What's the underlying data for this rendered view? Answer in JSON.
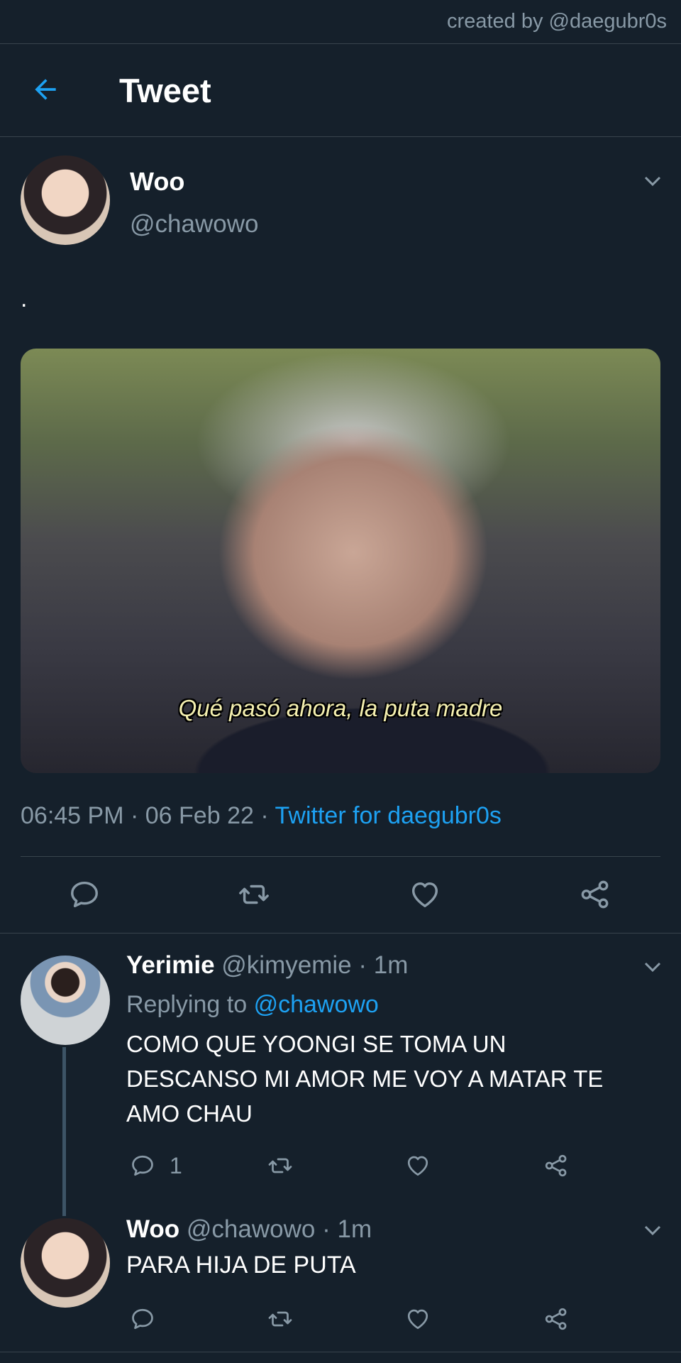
{
  "credit": "created by @daegubr0s",
  "header": {
    "title": "Tweet"
  },
  "tweet": {
    "display_name": "Woo",
    "handle": "@chawowo",
    "text": ".",
    "image_caption": "Qué pasó ahora, la puta madre",
    "time": "06:45 PM",
    "date": "06 Feb 22",
    "sep": "·",
    "source": "Twitter for daegubr0s"
  },
  "replies": [
    {
      "display_name": "Yerimie",
      "handle": "@kimyemie",
      "time": "· 1m",
      "replying_label": "Replying to",
      "replying_to": "@chawowo",
      "text_lines": [
        "COMO QUE YOONGI SE TOMA UN",
        "DESCANSO MI AMOR ME VOY A MATAR TE",
        "AMO CHAU"
      ],
      "reply_count": "1"
    },
    {
      "display_name": "Woo",
      "handle": "@chawowo",
      "time": "· 1m",
      "text": "PARA HIJA DE PUTA"
    }
  ],
  "icons": {
    "back": "arrow-left-icon",
    "caret": "chevron-down-icon",
    "reply": "reply-icon",
    "retweet": "retweet-icon",
    "like": "heart-icon",
    "share": "share-icon"
  },
  "colors": {
    "background": "#15202b",
    "accent": "#1da1f2",
    "muted": "#8899a6",
    "divider": "#38444d"
  }
}
